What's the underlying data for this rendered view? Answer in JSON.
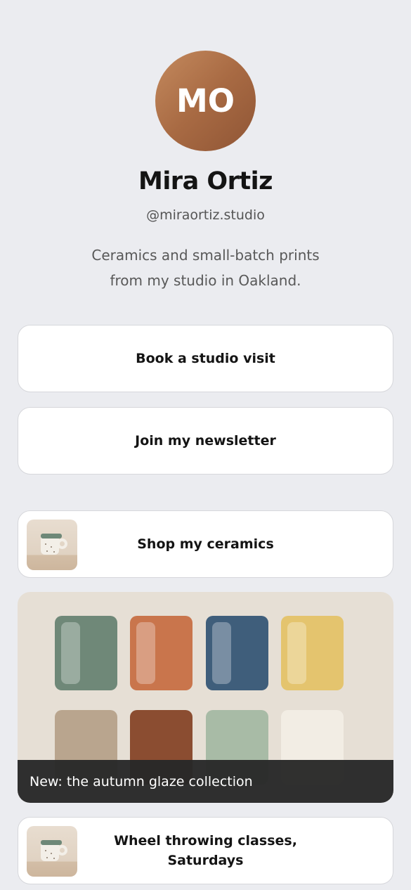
{
  "profile": {
    "initials": "MO",
    "name": "Mira Ortiz",
    "handle": "@miraortiz.studio",
    "bio_line1": "Ceramics and small-batch prints",
    "bio_line2": "from my studio in Oakland.",
    "avatar_color": "#a86a43"
  },
  "links": [
    {
      "label": "Book a studio visit"
    },
    {
      "label": "Join my newsletter"
    },
    {
      "label": "Shop my ceramics",
      "thumbnail": "mug-image"
    },
    {
      "label_line1": "Wheel throwing classes,",
      "label_line2": "Saturdays",
      "thumbnail": "mug-image"
    }
  ],
  "feature": {
    "caption": "New: the autumn glaze collection",
    "swatch_colors": [
      "#6f8878",
      "#c9754c",
      "#3f5e7b",
      "#e4c46e",
      "#b9a58e",
      "#8b4d31",
      "#a8bba6",
      "#f2ede4"
    ]
  }
}
